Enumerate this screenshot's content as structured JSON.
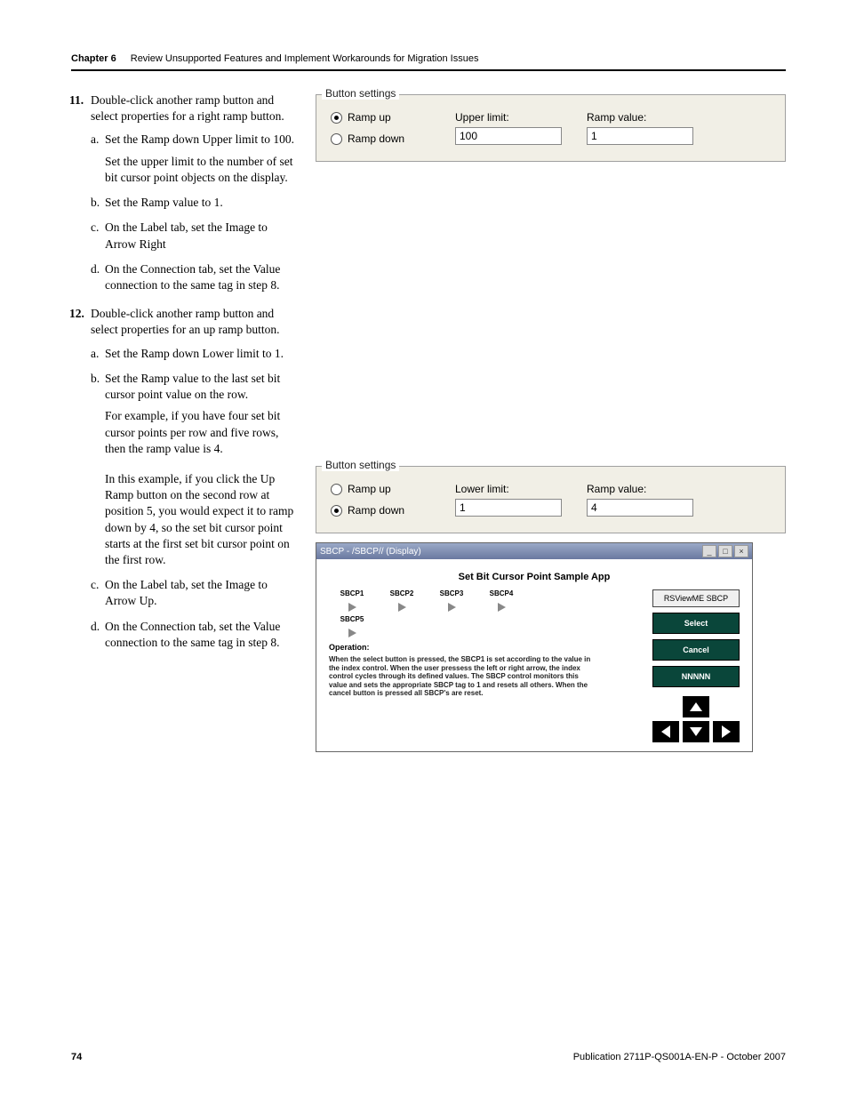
{
  "chapter_label": "Chapter 6",
  "chapter_title": "Review Unsupported Features and Implement Workarounds for Migration Issues",
  "steps": {
    "s11": {
      "number": "11.",
      "text": "Double-click another ramp button and select properties for a right ramp button.",
      "a": "Set the Ramp down Upper limit to 100.",
      "a_after": "Set the upper limit to the number of set bit cursor point objects on the display.",
      "b": "Set the Ramp value to 1.",
      "c": "On the Label tab, set the Image to Arrow Right",
      "d": "On the Connection tab, set the Value connection to the same tag in step 8."
    },
    "s12": {
      "number": "12.",
      "text": "Double-click another ramp button and select properties for an up ramp button.",
      "a": "Set the Ramp down Lower limit to 1.",
      "b": "Set the Ramp value to the last set bit cursor point value on the row.",
      "b_after1": "For example, if you have four set bit cursor points per row and five rows, then the ramp value is 4.",
      "b_after2": "In this example, if you click the Up Ramp button on the second row at position 5, you would expect it to ramp down by 4, so the set bit cursor point starts at the first set bit cursor point on the first row.",
      "c": "On the Label tab, set the Image to Arrow Up.",
      "d": "On the Connection tab, set the Value connection to the same tag in step 8."
    }
  },
  "fig1": {
    "legend": "Button settings",
    "ramp_up": "Ramp up",
    "ramp_down": "Ramp down",
    "upper_limit_label": "Upper limit:",
    "upper_limit_value": "100",
    "ramp_value_label": "Ramp value:",
    "ramp_value_value": "1"
  },
  "fig2": {
    "legend": "Button settings",
    "ramp_up": "Ramp up",
    "ramp_down": "Ramp down",
    "lower_limit_label": "Lower limit:",
    "lower_limit_value": "1",
    "ramp_value_label": "Ramp value:",
    "ramp_value_value": "4"
  },
  "fig3": {
    "titlebar": "SBCP - /SBCP// (Display)",
    "min": "_",
    "max": "□",
    "close": "×",
    "app_title": "Set Bit Cursor Point Sample App",
    "sbcp": [
      "SBCP1",
      "SBCP2",
      "SBCP3",
      "SBCP4",
      "SBCP5"
    ],
    "operation_label": "Operation:",
    "operation_text": "When the select button is pressed, the SBCP1 is set according to the value in the index control. When the user pressess the left or right arrow, the index control cycles through its defined values. The SBCP control monitors this value and sets the appropriate SBCP tag to 1 and resets all others. When the cancel button is pressed all SBCP's are reset.",
    "side_label": "RSViewME SBCP",
    "select": "Select",
    "cancel": "Cancel",
    "nnnnn": "NNNNN"
  },
  "footer": {
    "page": "74",
    "pub": "Publication 2711P-QS001A-EN-P - October 2007"
  }
}
